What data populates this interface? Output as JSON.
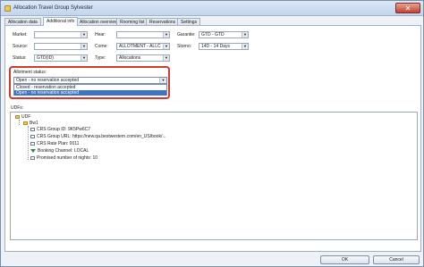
{
  "window": {
    "title": "Allocation Travel Group Sylvester",
    "close_glyph": "✕"
  },
  "tabs": [
    {
      "label": "Allocation data"
    },
    {
      "label": "Additional info"
    },
    {
      "label": "Allocation overview"
    },
    {
      "label": "Rooming list"
    },
    {
      "label": "Reservations"
    },
    {
      "label": "Settings"
    }
  ],
  "form": {
    "market": {
      "label": "Market:",
      "value": ""
    },
    "source": {
      "label": "Source:",
      "value": ""
    },
    "status": {
      "label": "Status:",
      "value": "GTD(ID)"
    },
    "hear": {
      "label": "Hear:",
      "value": ""
    },
    "come": {
      "label": "Come:",
      "value": "ALLOTMENT - ALLC"
    },
    "type": {
      "label": "Type:",
      "value": "Allocations"
    },
    "garantie": {
      "label": "Garantie:",
      "value": "GTD - GTD"
    },
    "storno": {
      "label": "Storno:",
      "value": "14D - 14 Days"
    }
  },
  "allotment": {
    "label": "Allotment status:",
    "selected": "Open - no reservation accepted",
    "options": [
      "Closed - reservation accepted",
      "Open - no reservation accepted"
    ]
  },
  "udfs": {
    "label": "UDFs:",
    "root": "UDF",
    "child": "Bw1",
    "items": [
      "CRS Group ID: 9K5Pw6C7",
      "CRS Group URL: https://new.qa.bestwestern.com/en_US/book/...",
      "CRS Rate Plan: 0011",
      "Booking Channel: LOCAL",
      "Promised number of nights: 10"
    ]
  },
  "buttons": {
    "ok": "OK",
    "cancel": "Cancel"
  },
  "icons": {
    "dropdown_arrow": "▼",
    "folder": "folder-icon",
    "filter": "filter-icon"
  }
}
